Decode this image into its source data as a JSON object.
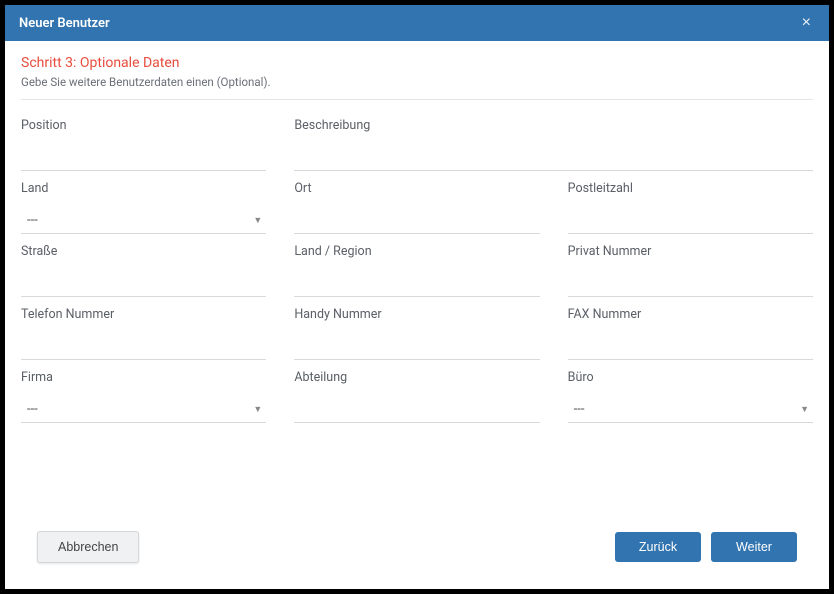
{
  "modal": {
    "title": "Neuer Benutzer",
    "close_glyph": "×"
  },
  "step": {
    "title": "Schritt 3: Optionale Daten",
    "subtitle": "Gebe Sie weitere Benutzerdaten einen (Optional)."
  },
  "fields": {
    "position": {
      "label": "Position",
      "value": ""
    },
    "description": {
      "label": "Beschreibung",
      "value": ""
    },
    "country": {
      "label": "Land",
      "selected": "---"
    },
    "city": {
      "label": "Ort",
      "value": ""
    },
    "postal_code": {
      "label": "Postleitzahl",
      "value": ""
    },
    "street": {
      "label": "Straße",
      "value": ""
    },
    "state_region": {
      "label": "Land / Region",
      "value": ""
    },
    "private_number": {
      "label": "Privat Nummer",
      "value": ""
    },
    "phone_number": {
      "label": "Telefon Nummer",
      "value": ""
    },
    "mobile_number": {
      "label": "Handy Nummer",
      "value": ""
    },
    "fax_number": {
      "label": "FAX Nummer",
      "value": ""
    },
    "company": {
      "label": "Firma",
      "selected": "---"
    },
    "department": {
      "label": "Abteilung",
      "value": ""
    },
    "office": {
      "label": "Büro",
      "selected": "---"
    }
  },
  "footer": {
    "cancel": "Abbrechen",
    "back": "Zurück",
    "next": "Weiter"
  }
}
